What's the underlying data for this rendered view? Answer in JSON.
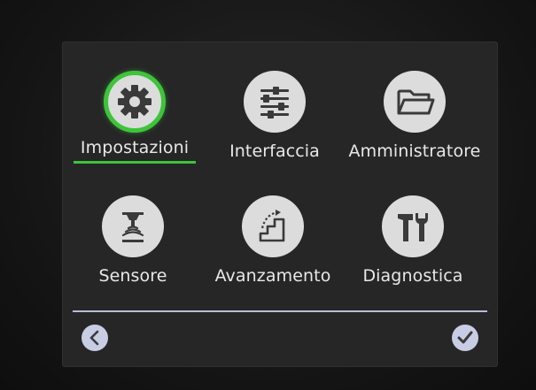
{
  "menu": {
    "items": [
      {
        "label": "Impostazioni",
        "icon": "gear-icon",
        "selected": true
      },
      {
        "label": "Interfaccia",
        "icon": "sliders-icon",
        "selected": false
      },
      {
        "label": "Amministratore",
        "icon": "folder-icon",
        "selected": false
      },
      {
        "label": "Sensore",
        "icon": "sensor-icon",
        "selected": false
      },
      {
        "label": "Avanzamento",
        "icon": "stairs-icon",
        "selected": false
      },
      {
        "label": "Diagnostica",
        "icon": "tools-icon",
        "selected": false
      }
    ]
  },
  "footer": {
    "back_icon": "chevron-left-icon",
    "confirm_icon": "checkmark-icon"
  },
  "colors": {
    "selection": "#3ec43a",
    "icon_background": "#dcdcdc",
    "screen_background": "#262626",
    "label_text": "#e8e8e8",
    "nav_button": "#c8cce4"
  }
}
